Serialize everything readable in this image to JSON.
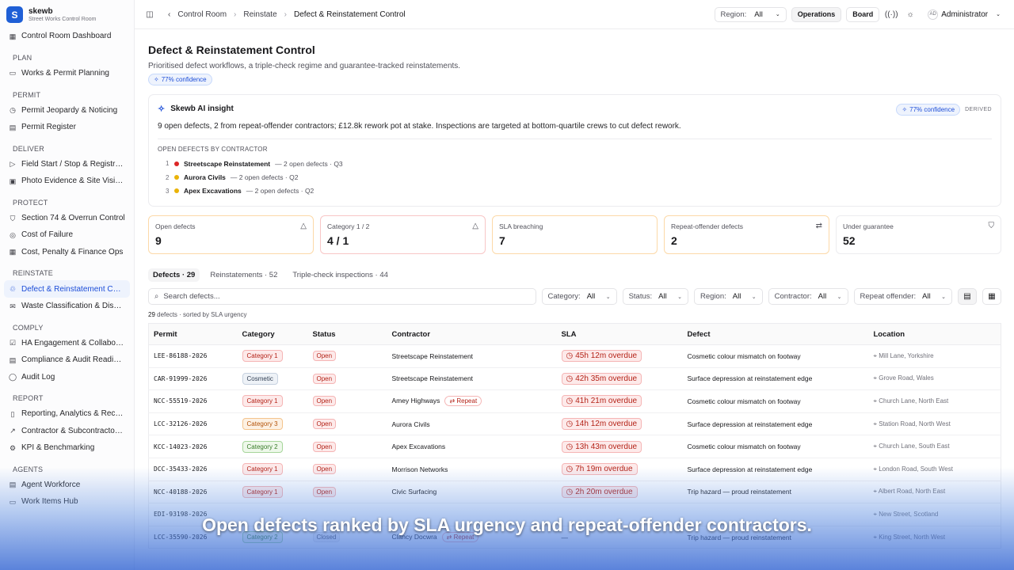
{
  "brand": {
    "name": "skewb",
    "subtitle": "Street Works Control Room",
    "logo_letter": "S"
  },
  "sidebar": {
    "top_item": "Control Room Dashboard",
    "sections": [
      {
        "title": "PLAN",
        "items": [
          "Works & Permit Planning"
        ]
      },
      {
        "title": "PERMIT",
        "items": [
          "Permit Jeopardy & Noticing",
          "Permit Register"
        ]
      },
      {
        "title": "DELIVER",
        "items": [
          "Field Start / Stop & Registrati...",
          "Photo Evidence & Site Visibility"
        ]
      },
      {
        "title": "PROTECT",
        "items": [
          "Section 74 & Overrun Control",
          "Cost of Failure",
          "Cost, Penalty & Finance Ops"
        ]
      },
      {
        "title": "REINSTATE",
        "items": [
          "Defect & Reinstatement Con...",
          "Waste Classification & Dispos..."
        ]
      },
      {
        "title": "COMPLY",
        "items": [
          "HA Engagement & Collaborati...",
          "Compliance & Audit Readiness",
          "Audit Log"
        ]
      },
      {
        "title": "REPORT",
        "items": [
          "Reporting, Analytics & Records",
          "Contractor & Subcontractor P...",
          "KPI & Benchmarking"
        ]
      },
      {
        "title": "AGENTS",
        "items": [
          "Agent Workforce",
          "Work Items Hub"
        ]
      }
    ],
    "active_item": "Defect & Reinstatement Con..."
  },
  "topbar": {
    "breadcrumb": [
      "Control Room",
      "Reinstate",
      "Defect & Reinstatement Control"
    ],
    "region_label": "Region:",
    "region_value": "All",
    "operations": "Operations",
    "board": "Board",
    "avatar_initials": "AD",
    "user": "Administrator"
  },
  "page": {
    "title": "Defect & Reinstatement Control",
    "subtitle": "Prioritised defect workflows, a triple-check regime and guarantee-tracked reinstatements.",
    "confidence": "77% confidence"
  },
  "insight": {
    "title": "Skewb AI insight",
    "confidence": "77% confidence",
    "derived": "DERIVED",
    "text": "9 open defects, 2 from repeat-offender contractors; £12.8k rework pot at stake. Inspections are targeted at bottom-quartile crews to cut defect rework.",
    "list_label": "OPEN DEFECTS BY CONTRACTOR",
    "ranking": [
      {
        "rank": "1",
        "name": "Streetscape Reinstatement",
        "detail": "— 2 open defects · Q3",
        "color": "#dc2626"
      },
      {
        "rank": "2",
        "name": "Aurora Civils",
        "detail": "— 2 open defects · Q2",
        "color": "#eab308"
      },
      {
        "rank": "3",
        "name": "Apex Excavations",
        "detail": "— 2 open defects · Q2",
        "color": "#eab308"
      }
    ]
  },
  "kpis": [
    {
      "label": "Open defects",
      "value": "9",
      "icon": "△"
    },
    {
      "label": "Category 1 / 2",
      "value": "4 / 1",
      "icon": "△"
    },
    {
      "label": "SLA breaching",
      "value": "7",
      "icon": ""
    },
    {
      "label": "Repeat-offender defects",
      "value": "2",
      "icon": "⇄"
    },
    {
      "label": "Under guarantee",
      "value": "52",
      "icon": "⛉"
    }
  ],
  "tabs": [
    "Defects · 29",
    "Reinstatements · 52",
    "Triple-check inspections · 44"
  ],
  "filters": {
    "search_placeholder": "Search defects...",
    "category_label": "Category:",
    "category_value": "All",
    "status_label": "Status:",
    "status_value": "All",
    "region_label": "Region:",
    "region_value": "All",
    "contractor_label": "Contractor:",
    "contractor_value": "All",
    "repeat_label": "Repeat offender:",
    "repeat_value": "All"
  },
  "count": {
    "n": "29",
    "text": "defects · sorted by SLA urgency"
  },
  "table": {
    "headers": [
      "Permit",
      "Category",
      "Status",
      "Contractor",
      "SLA",
      "Defect",
      "Location"
    ],
    "rows": [
      {
        "permit": "LEE-86188-2026",
        "category": "Category 1",
        "cat_class": "c1",
        "status": "Open",
        "contractor": "Streetscape Reinstatement",
        "repeat": "",
        "sla": "45h 12m overdue",
        "defect": "Cosmetic colour mismatch on footway",
        "location": "Mill Lane, Yorkshire"
      },
      {
        "permit": "CAR-91999-2026",
        "category": "Cosmetic",
        "cat_class": "cc",
        "status": "Open",
        "contractor": "Streetscape Reinstatement",
        "repeat": "",
        "sla": "42h 35m overdue",
        "defect": "Surface depression at reinstatement edge",
        "location": "Grove Road, Wales"
      },
      {
        "permit": "NCC-55519-2026",
        "category": "Category 1",
        "cat_class": "c1",
        "status": "Open",
        "contractor": "Amey Highways",
        "repeat": "Repeat",
        "sla": "41h 21m overdue",
        "defect": "Cosmetic colour mismatch on footway",
        "location": "Church Lane, North East"
      },
      {
        "permit": "LCC-32126-2026",
        "category": "Category 3",
        "cat_class": "c3",
        "status": "Open",
        "contractor": "Aurora Civils",
        "repeat": "",
        "sla": "14h 12m overdue",
        "defect": "Surface depression at reinstatement edge",
        "location": "Station Road, North West"
      },
      {
        "permit": "KCC-14023-2026",
        "category": "Category 2",
        "cat_class": "c2",
        "status": "Open",
        "contractor": "Apex Excavations",
        "repeat": "",
        "sla": "13h 43m overdue",
        "defect": "Cosmetic colour mismatch on footway",
        "location": "Church Lane, South East"
      },
      {
        "permit": "DCC-35433-2026",
        "category": "Category 1",
        "cat_class": "c1",
        "status": "Open",
        "contractor": "Morrison Networks",
        "repeat": "",
        "sla": "7h 19m overdue",
        "defect": "Surface depression at reinstatement edge",
        "location": "London Road, South West"
      },
      {
        "permit": "NCC-40188-2026",
        "category": "Category 1",
        "cat_class": "c1",
        "status": "Open",
        "contractor": "Civic Surfacing",
        "repeat": "",
        "sla": "2h 20m overdue",
        "defect": "Trip hazard — proud reinstatement",
        "location": "Albert Road, North East"
      },
      {
        "permit": "EDI-93198-2026",
        "category": "",
        "cat_class": "cc",
        "status": "",
        "contractor": "",
        "repeat": "",
        "sla": "",
        "defect": "",
        "location": "New Street, Scotland"
      },
      {
        "permit": "LCC-35590-2026",
        "category": "Category 2",
        "cat_class": "c2",
        "status": "Closed",
        "contractor": "Clancy Docwra",
        "repeat": "Repeat",
        "sla": "—",
        "defect": "Trip hazard — proud reinstatement",
        "location": "King Street, North West"
      }
    ]
  },
  "caption": "Open defects ranked by SLA urgency and repeat-offender contractors."
}
